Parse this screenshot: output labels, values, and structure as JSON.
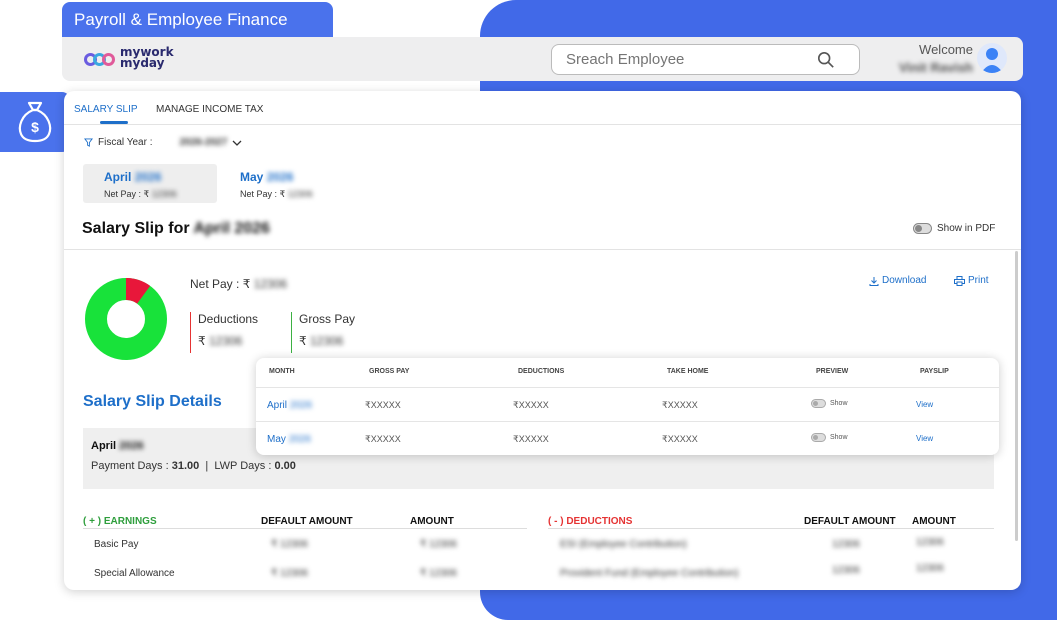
{
  "app": {
    "title": "Payroll & Employee Finance",
    "brand_line1": "mywork",
    "brand_line2": "myday"
  },
  "header": {
    "search_placeholder": "Sreach Employee",
    "welcome": "Welcome",
    "user_name": "Vinit Ravish"
  },
  "tabs": [
    {
      "label": "SALARY SLIP",
      "active": true
    },
    {
      "label": "MANAGE INCOME TAX",
      "active": false
    }
  ],
  "filter": {
    "label": "Fiscal Year :",
    "value": "2026-2027"
  },
  "months": [
    {
      "name": "April",
      "year": "2026",
      "net_pay_label": "Net Pay : ₹",
      "net_pay": "12306",
      "selected": true
    },
    {
      "name": "May",
      "year": "2026",
      "net_pay_label": "Net Pay : ₹",
      "net_pay": "12306",
      "selected": false
    }
  ],
  "slip": {
    "title": "Salary Slip for",
    "period": "April 2026",
    "show_pdf_label": "Show in PDF"
  },
  "summary": {
    "net_pay_label": "Net Pay :",
    "currency": "₹",
    "net_pay": "12306",
    "deductions_label": "Deductions",
    "deductions": "12306",
    "gross_label": "Gross Pay",
    "gross": "12306",
    "download_label": "Download",
    "print_label": "Print",
    "donut": {
      "deductions_fraction": 0.1,
      "colors": {
        "deductions": "#e8173a",
        "gross": "#18e23a"
      }
    }
  },
  "details": {
    "title": "Salary Slip Details",
    "month": "April",
    "year": "2026",
    "payment_days_label": "Payment Days :",
    "payment_days": "31.00",
    "lwp_label": "LWP Days :",
    "lwp_days": "0.00"
  },
  "earnings": {
    "header": "( + ) EARNINGS",
    "default_col": "DEFAULT AMOUNT",
    "amount_col": "AMOUNT",
    "rows": [
      {
        "label": "Basic Pay",
        "default": "₹ 12306",
        "amount": "₹ 12306"
      },
      {
        "label": "Special Allowance",
        "default": "₹ 12306",
        "amount": "₹ 12306"
      }
    ]
  },
  "deductions_table": {
    "header": "( - ) DEDUCTIONS",
    "default_col": "DEFAULT AMOUNT",
    "amount_col": "AMOUNT",
    "rows": [
      {
        "label": "ESI (Employee Contribution)",
        "default": "12306",
        "amount": "12306"
      },
      {
        "label": "Provident Fund (Employee Contribution)",
        "default": "12306",
        "amount": "12306"
      }
    ]
  },
  "popup": {
    "columns": [
      "MONTH",
      "GROSS PAY",
      "DEDUCTIONS",
      "TAKE HOME",
      "PREVIEW",
      "PAYSLIP"
    ],
    "rows": [
      {
        "month": "April",
        "year": "2026",
        "gross": "₹XXXXX",
        "deductions": "₹XXXXX",
        "take_home": "₹XXXXX",
        "preview": "Show",
        "payslip": "View"
      },
      {
        "month": "May",
        "year": "2026",
        "gross": "₹XXXXX",
        "deductions": "₹XXXXX",
        "take_home": "₹XXXXX",
        "preview": "Show",
        "payslip": "View"
      }
    ]
  },
  "colors": {
    "accent": "#4a72ec",
    "link": "#1e6fc9",
    "deduction": "#e53333",
    "earning": "#3cb043"
  }
}
